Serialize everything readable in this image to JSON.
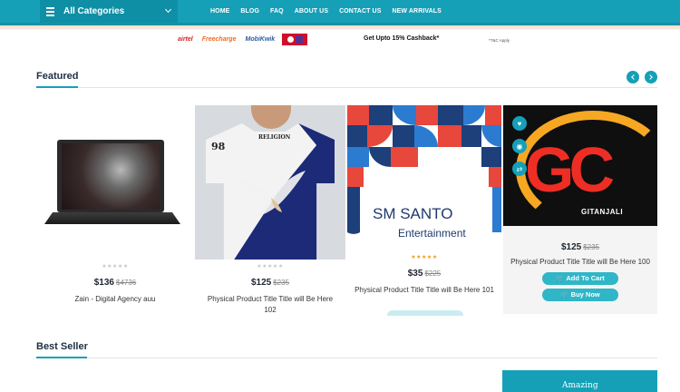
{
  "nav": {
    "category_label": "All Categories",
    "menu": [
      "HOME",
      "BLOG",
      "FAQ",
      "ABOUT US",
      "CONTACT US",
      "NEW ARRIVALS"
    ]
  },
  "offers": {
    "wallets": [
      "airtel",
      "Freecharge",
      "MobiKwik"
    ],
    "cashback": "Get Upto 15% Cashback*",
    "tnc": "*T&C Apply"
  },
  "featured": {
    "title": "Featured",
    "products": [
      {
        "price": "$136",
        "old_price": "$4736",
        "title": "Zain - Digital Agency auu",
        "stars": "★★★★★"
      },
      {
        "price": "$125",
        "old_price": "$235",
        "title": "Physical Product Title Title will Be Here 102",
        "stars": "★★★★★",
        "tee_text": "RELIGION",
        "tee_number": "98"
      },
      {
        "price": "$35",
        "old_price": "$225",
        "title": "Physical Product Title Title will Be Here 101",
        "stars": "★★★★★",
        "image_line1": "SM SANTO",
        "image_line2": "Entertainment"
      },
      {
        "price": "$125",
        "old_price": "$235",
        "title": "Physical Product Title Title will Be Here 100",
        "image_word": "GITANJALI",
        "image_letters": "GC",
        "add_to_cart": "Add To Cart",
        "buy_now": "Buy Now"
      }
    ]
  },
  "best_seller": {
    "title": "Best Seller",
    "banner_text": "Amazing"
  },
  "colors": {
    "accent": "#16a0b8",
    "rating": "#f29a1a"
  }
}
